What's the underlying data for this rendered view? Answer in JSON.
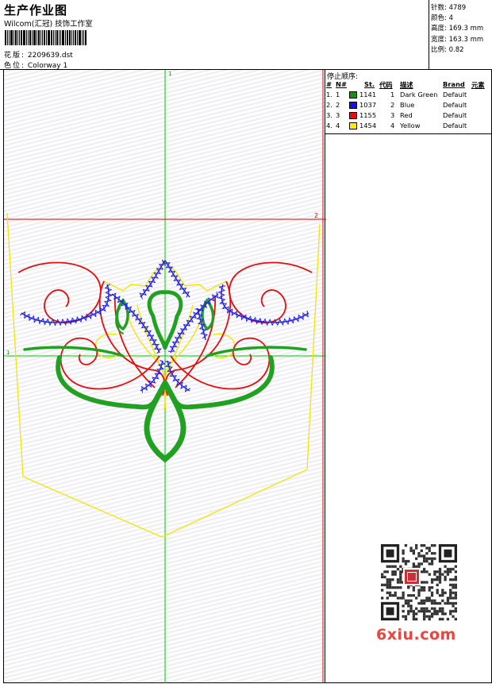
{
  "header": {
    "title": "生产作业图",
    "subtitle": "Wilcom(汇冠) 技饰工作室",
    "design_label": "花版:",
    "design_file": "2209639.dst",
    "colorway_label": "色位:",
    "colorway": "Colorway 1"
  },
  "stats": [
    {
      "label": "针数:",
      "value": "4789"
    },
    {
      "label": "颜色:",
      "value": "4"
    },
    {
      "label": "高度:",
      "value": "169.3 mm"
    },
    {
      "label": "宽度:",
      "value": "163.3 mm"
    },
    {
      "label": "比例:",
      "value": "0.82"
    }
  ],
  "stop_sequence": {
    "title": "停止顺序:",
    "headers": {
      "index": "#",
      "num": "N#",
      "stitch": "St.",
      "code": "代码",
      "desc": "描述",
      "brand": "Brand",
      "element": "元素"
    },
    "rows": [
      {
        "index": "1.",
        "num": "1",
        "color": "#1a8c1a",
        "stitch": "1141",
        "code": "1",
        "desc": "Dark Green",
        "brand": "Default"
      },
      {
        "index": "2.",
        "num": "2",
        "color": "#1515d8",
        "stitch": "1037",
        "code": "2",
        "desc": "Blue",
        "brand": "Default"
      },
      {
        "index": "3.",
        "num": "3",
        "color": "#e01010",
        "stitch": "1155",
        "code": "3",
        "desc": "Red",
        "brand": "Default"
      },
      {
        "index": "4.",
        "num": "4",
        "color": "#ffee00",
        "stitch": "1454",
        "code": "4",
        "desc": "Yellow",
        "brand": "Default"
      }
    ]
  },
  "design_area": {
    "guide_top_label": "1",
    "guide_left_label": "1",
    "guide_right_label": "2",
    "colors": {
      "green": "#22a022",
      "blue": "#2020e0",
      "red": "#e01010",
      "yellow": "#f2e600",
      "guide_green": "#00cc00",
      "guide_red": "#dd0000"
    }
  },
  "watermark": {
    "text": "6xiu.com"
  }
}
